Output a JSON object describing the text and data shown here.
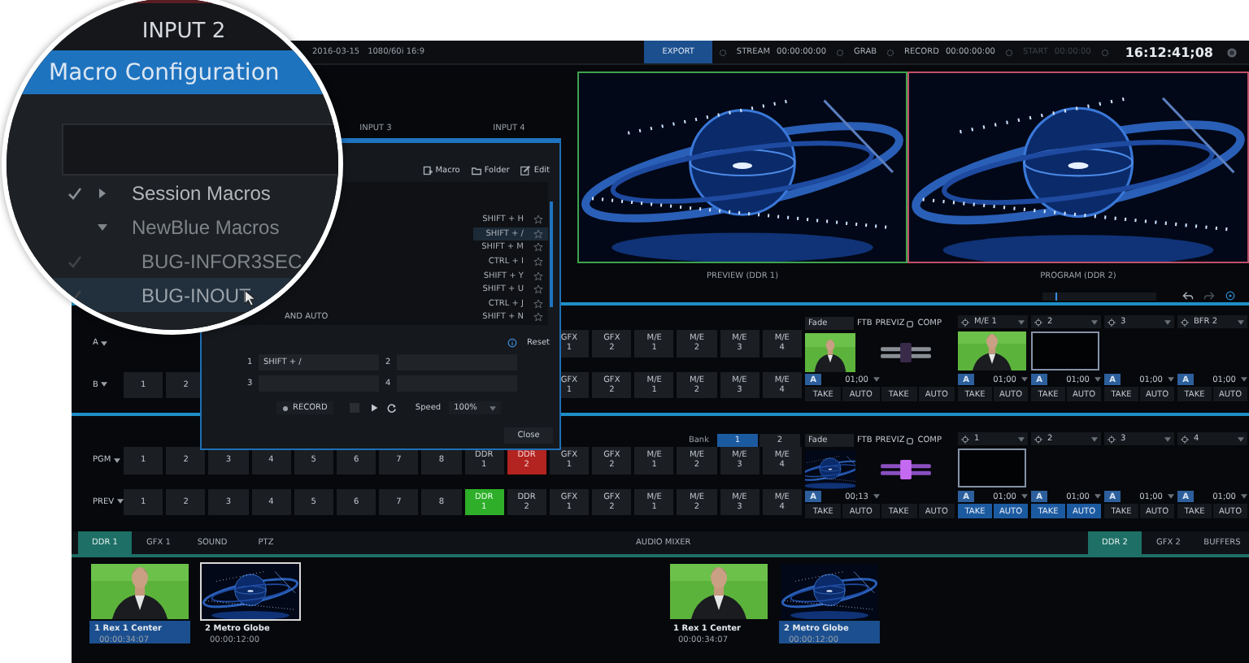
{
  "magnifier": {
    "input_label": "INPUT 2",
    "dialog_title": "Macro Configuration",
    "tree": [
      {
        "label": "Session Macros",
        "checked": true,
        "expanded": false,
        "selected": false
      },
      {
        "label": "NewBlue Macros",
        "checked": false,
        "expanded": true,
        "selected": false,
        "children": [
          {
            "label": "BUG-INFOR3SEC",
            "checked": true,
            "selected": false
          },
          {
            "label": "BUG-INOUT",
            "checked": true,
            "selected": true
          }
        ]
      }
    ]
  },
  "top_bar": {
    "date": "2016-03-15",
    "format": "1080/60i 16:9",
    "outputs": [
      {
        "label": "EXPORT",
        "selected": true,
        "disabled": false
      },
      {
        "label": "STREAM",
        "time": "00:00:00:00",
        "selected": false,
        "disabled": false
      },
      {
        "label": "GRAB",
        "selected": false,
        "disabled": false
      },
      {
        "label": "RECORD",
        "time": "00:00:00:00",
        "selected": false,
        "disabled": false
      },
      {
        "label": "START",
        "time": "00:00:00",
        "selected": false,
        "disabled": true
      }
    ],
    "clock": "16:12:41;08"
  },
  "inputs": [
    "INPUT 3",
    "INPUT 4"
  ],
  "monitors": [
    {
      "label": "PREVIEW (DDR 1)",
      "kind": "preview"
    },
    {
      "label": "PROGRAM (DDR 2)",
      "kind": "program"
    }
  ],
  "macro_dialog": {
    "toolbar": [
      {
        "label": "Macro",
        "kind": "macro"
      },
      {
        "label": "Folder",
        "kind": "folder"
      },
      {
        "label": "Edit",
        "kind": "edit"
      }
    ],
    "macros": [
      {
        "shortcut": "SHIFT + H",
        "selected": false
      },
      {
        "shortcut": "SHIFT + /",
        "selected": true
      },
      {
        "shortcut": "SHIFT + M",
        "selected": false
      },
      {
        "shortcut": "CTRL + I",
        "selected": false
      },
      {
        "shortcut": "SHIFT + Y",
        "selected": false
      },
      {
        "shortcut": "SHIFT + U",
        "selected": false
      },
      {
        "shortcut": "CTRL + J",
        "selected": false
      },
      {
        "name": "AND AUTO",
        "shortcut": "SHIFT + N",
        "selected": false
      }
    ],
    "reset": "Reset",
    "slots": [
      {
        "number": "1",
        "value": "SHIFT + /"
      },
      {
        "number": "2"
      },
      {
        "number": "3"
      },
      {
        "number": "4"
      }
    ],
    "record": "RECORD",
    "speed_label": "Speed",
    "speed": "100%",
    "close": "Close"
  },
  "switcher_sections": [
    {
      "rows": [
        {
          "label": "A",
          "end_buttons": [
            {
              "label": "GFX 1"
            },
            {
              "label": "GFX 2"
            },
            {
              "label": "M/E 1"
            },
            {
              "label": "M/E 2"
            },
            {
              "label": "M/E 3"
            },
            {
              "label": "M/E 4"
            }
          ]
        },
        {
          "label": "B",
          "buttons": [
            {
              "label": "1"
            },
            {
              "label": "2"
            }
          ],
          "end_buttons": [
            {
              "label": "GFX 1"
            },
            {
              "label": "GFX 2"
            },
            {
              "label": "M/E 1"
            },
            {
              "label": "M/E 2"
            },
            {
              "label": "M/E 3"
            },
            {
              "label": "M/E 4"
            }
          ]
        }
      ],
      "transition": {
        "mode": "Fade",
        "ftb": "FTB",
        "previz": "PREVIZ",
        "comp": "COMP",
        "thumb": {
          "kind": "person"
        },
        "tbar_lit": false,
        "key_label": "A",
        "duration": "01;00",
        "buttons": [
          "TAKE",
          "AUTO",
          "TAKE",
          "AUTO"
        ]
      },
      "channels": [
        {
          "label": "M/E 1",
          "thumb": {
            "kind": "person"
          },
          "key_label": "A",
          "duration": "01;00",
          "take": "TAKE",
          "auto": "AUTO",
          "active": false
        },
        {
          "label": "2",
          "thumb": {
            "kind": "frame"
          },
          "key_label": "A",
          "duration": "01;00",
          "take": "TAKE",
          "auto": "AUTO",
          "active": false
        },
        {
          "label": "3",
          "key_label": "A",
          "duration": "01;00",
          "take": "TAKE",
          "auto": "AUTO",
          "active": false
        },
        {
          "label": "BFR 2",
          "key_label": "A",
          "duration": "01;00",
          "take": "TAKE",
          "auto": "AUTO",
          "active": false
        }
      ]
    },
    {
      "bank": {
        "label": "Bank",
        "options": [
          {
            "label": "1",
            "selected": true
          },
          {
            "label": "2",
            "selected": false
          }
        ]
      },
      "rows": [
        {
          "label": "PGM",
          "kind": "program",
          "buttons": [
            {
              "label": "1",
              "selected": false
            },
            {
              "label": "2",
              "selected": false
            },
            {
              "label": "3",
              "selected": false
            },
            {
              "label": "4",
              "selected": false
            },
            {
              "label": "5",
              "selected": false
            },
            {
              "label": "6",
              "selected": false
            },
            {
              "label": "7",
              "selected": false
            },
            {
              "label": "8",
              "selected": false
            },
            {
              "label": "DDR 1",
              "selected": false
            },
            {
              "label": "DDR 2",
              "selected": true
            },
            {
              "label": "GFX 1",
              "selected": false
            },
            {
              "label": "GFX 2",
              "selected": false
            },
            {
              "label": "M/E 1",
              "selected": false
            },
            {
              "label": "M/E 2",
              "selected": false
            },
            {
              "label": "M/E 3",
              "selected": false
            },
            {
              "label": "M/E 4",
              "selected": false
            }
          ]
        },
        {
          "label": "PREV",
          "kind": "preview",
          "buttons": [
            {
              "label": "1",
              "selected": false
            },
            {
              "label": "2",
              "selected": false
            },
            {
              "label": "3",
              "selected": false
            },
            {
              "label": "4",
              "selected": false
            },
            {
              "label": "5",
              "selected": false
            },
            {
              "label": "6",
              "selected": false
            },
            {
              "label": "7",
              "selected": false
            },
            {
              "label": "8",
              "selected": false
            },
            {
              "label": "DDR 1",
              "selected": true
            },
            {
              "label": "DDR 2",
              "selected": false
            },
            {
              "label": "GFX 1",
              "selected": false
            },
            {
              "label": "GFX 2",
              "selected": false
            },
            {
              "label": "M/E 1",
              "selected": false
            },
            {
              "label": "M/E 2",
              "selected": false
            },
            {
              "label": "M/E 3",
              "selected": false
            },
            {
              "label": "M/E 4",
              "selected": false
            }
          ]
        }
      ],
      "transition": {
        "mode": "Fade",
        "ftb": "FTB",
        "previz": "PREVIZ",
        "comp": "COMP",
        "thumb": {
          "kind": "globe"
        },
        "tbar_lit": true,
        "key_label": "A",
        "duration": "00;13",
        "buttons": [
          "TAKE",
          "AUTO",
          "TAKE",
          "AUTO"
        ]
      },
      "channels": [
        {
          "label": "1",
          "thumb": {
            "kind": "frame"
          },
          "key_label": "A",
          "duration": "01;00",
          "take": "TAKE",
          "auto": "AUTO",
          "active": true
        },
        {
          "label": "2",
          "key_label": "A",
          "duration": "01;00",
          "take": "TAKE",
          "auto": "AUTO",
          "active": true
        },
        {
          "label": "3",
          "key_label": "A",
          "duration": "01;00",
          "take": "TAKE",
          "auto": "AUTO",
          "active": false
        },
        {
          "label": "4",
          "key_label": "A",
          "duration": "01;00",
          "take": "TAKE",
          "auto": "AUTO",
          "active": false
        }
      ]
    }
  ],
  "tabs": {
    "left": [
      {
        "label": "DDR 1",
        "selected": true
      },
      {
        "label": "GFX 1",
        "selected": false
      },
      {
        "label": "SOUND",
        "selected": false
      },
      {
        "label": "PTZ",
        "selected": false
      }
    ],
    "center": [
      {
        "label": "AUDIO MIXER",
        "selected": false
      }
    ],
    "right": [
      {
        "label": "DDR 2",
        "selected": true
      },
      {
        "label": "GFX 2",
        "selected": false
      },
      {
        "label": "BUFFERS",
        "selected": false
      }
    ]
  },
  "bins": [
    {
      "clips": [
        {
          "title": "1 Rex 1 Center",
          "duration": "00:00:34:07",
          "thumb": {
            "kind": "person"
          },
          "selected": true,
          "focused": false
        },
        {
          "title": "2 Metro Globe",
          "duration": "00:00:12:00",
          "thumb": {
            "kind": "globe"
          },
          "selected": false,
          "focused": true
        }
      ]
    },
    {
      "clips": [
        {
          "title": "1 Rex 1 Center",
          "duration": "00:00:34:07",
          "thumb": {
            "kind": "person"
          },
          "selected": false,
          "focused": false
        },
        {
          "title": "2 Metro Globe",
          "duration": "00:00:12:00",
          "thumb": {
            "kind": "globe"
          },
          "selected": true,
          "focused": false
        }
      ]
    }
  ]
}
